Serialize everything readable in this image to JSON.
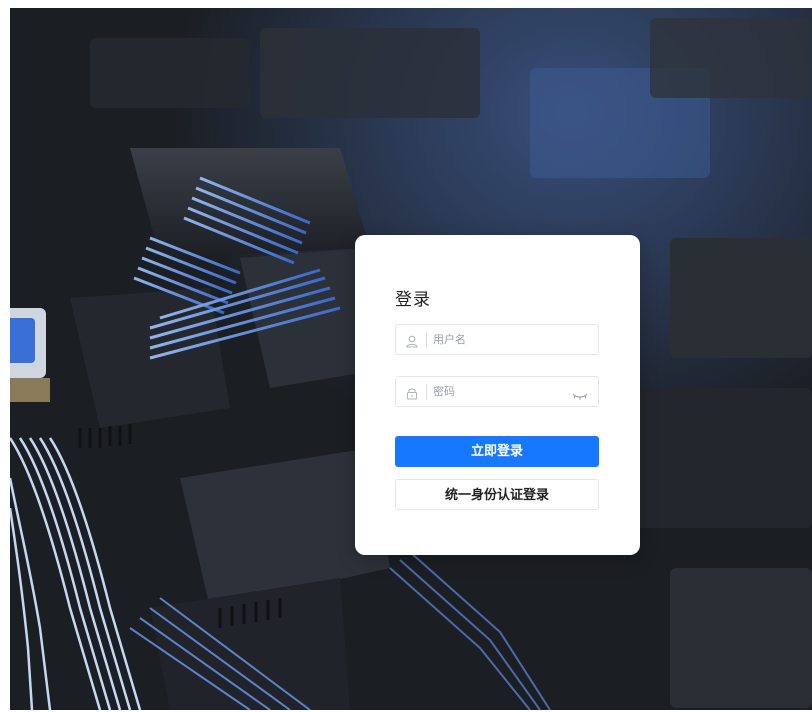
{
  "login": {
    "title": "登录",
    "username_placeholder": "用户名",
    "password_placeholder": "密码",
    "login_button": "立即登录",
    "sso_button": "统一身份认证登录"
  },
  "colors": {
    "primary": "#1677ff",
    "card_bg": "#ffffff",
    "border": "#e4e6ea"
  },
  "icons": {
    "username": "user-icon",
    "password": "lock-icon",
    "toggle": "eye-closed-icon"
  }
}
